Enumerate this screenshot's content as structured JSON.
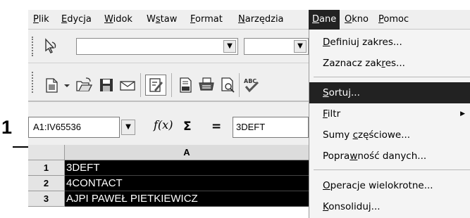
{
  "callout": {
    "label": "1"
  },
  "menubar": {
    "items": [
      "Plik",
      "Edycja",
      "Widok",
      "Wstaw",
      "Format",
      "Narzędzia",
      "Dane",
      "Okno",
      "Pomoc"
    ],
    "active": "Dane"
  },
  "toolbar": {
    "combo1_value": "",
    "combo2_value": "",
    "icons": [
      "apply-style-icon",
      "new-document-icon",
      "open-folder-icon",
      "save-icon",
      "email-icon",
      "edit-mode-icon",
      "export-pdf-icon",
      "print-icon",
      "page-preview-icon",
      "spellcheck-icon"
    ]
  },
  "formula_bar": {
    "name_box": "A1:IV65536",
    "fx_label": "f(x)",
    "sigma_label": "Σ",
    "equals_label": "=",
    "content": "3DEFT"
  },
  "sheet": {
    "column_header": "A",
    "rows": [
      {
        "num": "1",
        "value": "3DEFT"
      },
      {
        "num": "2",
        "value": "4CONTACT"
      },
      {
        "num": "3",
        "value": "AJPI PAWEŁ PIETKIEWICZ"
      }
    ]
  },
  "dropdown": {
    "items": [
      "Definiuj zakres...",
      "Zaznacz zakres...",
      "Sortuj...",
      "Filtr",
      "Sumy częściowe...",
      "Poprawność danych...",
      "Operacje wielokrotne...",
      "Konsoliduj..."
    ],
    "highlighted": "Sortuj..."
  }
}
